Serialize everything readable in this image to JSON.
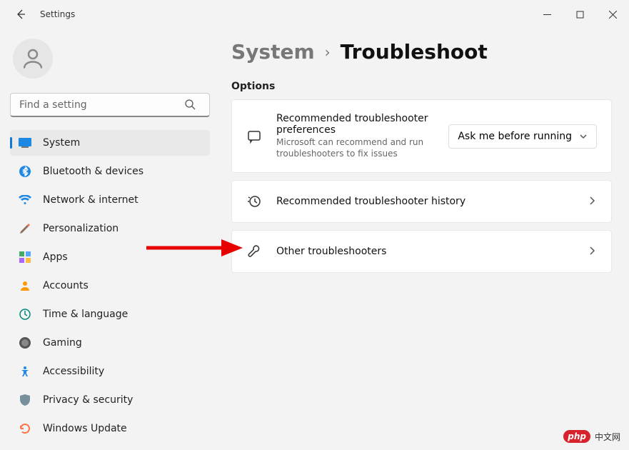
{
  "window": {
    "title": "Settings"
  },
  "search": {
    "placeholder": "Find a setting"
  },
  "nav": {
    "items": [
      {
        "label": "System"
      },
      {
        "label": "Bluetooth & devices"
      },
      {
        "label": "Network & internet"
      },
      {
        "label": "Personalization"
      },
      {
        "label": "Apps"
      },
      {
        "label": "Accounts"
      },
      {
        "label": "Time & language"
      },
      {
        "label": "Gaming"
      },
      {
        "label": "Accessibility"
      },
      {
        "label": "Privacy & security"
      },
      {
        "label": "Windows Update"
      }
    ]
  },
  "breadcrumb": {
    "parent": "System",
    "current": "Troubleshoot"
  },
  "section": {
    "label": "Options"
  },
  "cards": {
    "pref": {
      "title": "Recommended troubleshooter preferences",
      "sub": "Microsoft can recommend and run troubleshooters to fix issues",
      "dropdown": "Ask me before running"
    },
    "history": {
      "title": "Recommended troubleshooter history"
    },
    "other": {
      "title": "Other troubleshooters"
    }
  },
  "watermark": {
    "badge": "php",
    "text": "中文网"
  }
}
